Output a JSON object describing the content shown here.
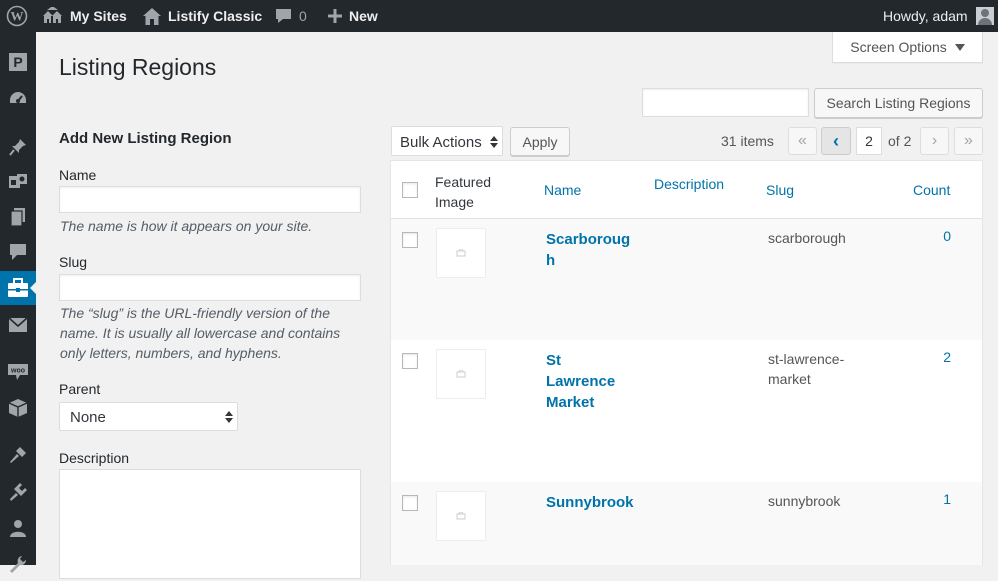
{
  "admin_bar": {
    "my_sites": "My Sites",
    "site_name": "Listify Classic",
    "comments_count": "0",
    "new_label": "New",
    "howdy": "Howdy, adam"
  },
  "page": {
    "title": "Listing Regions",
    "screen_options": "Screen Options"
  },
  "search": {
    "value": "",
    "button": "Search Listing Regions"
  },
  "form": {
    "heading": "Add New Listing Region",
    "name_label": "Name",
    "name_value": "",
    "name_help": "The name is how it appears on your site.",
    "slug_label": "Slug",
    "slug_value": "",
    "slug_help_lines": [
      "The “slug” is the URL-friendly version of the",
      "name. It is usually all lowercase and contains",
      "only letters, numbers, and hyphens."
    ],
    "parent_label": "Parent",
    "parent_selected": "None",
    "description_label": "Description",
    "description_value": ""
  },
  "tablenav": {
    "bulk_actions": "Bulk Actions",
    "apply": "Apply",
    "items_count": "31 items",
    "first_page": "«",
    "prev_page": "‹",
    "current_page": "2",
    "of_pages": "of 2",
    "next_page": "›",
    "last_page": "»"
  },
  "table": {
    "headers": {
      "featured_line1": "Featured",
      "featured_line2": "Image",
      "name": "Name",
      "description": "Description",
      "slug": "Slug",
      "count": "Count"
    },
    "rows": [
      {
        "name_lines": [
          "Scarboroug",
          "h"
        ],
        "slug_lines": [
          "scarborough"
        ],
        "count": "0"
      },
      {
        "name_lines": [
          "St",
          "Lawrence",
          "Market"
        ],
        "slug_lines": [
          "st-lawrence-",
          "market"
        ],
        "count": "2"
      },
      {
        "name_lines": [
          "Sunnybrook"
        ],
        "slug_lines": [
          "sunnybrook"
        ],
        "count": "1"
      }
    ]
  },
  "colors": {
    "admin_bar_bg": "#23282d",
    "accent_blue": "#0073aa",
    "page_bg": "#f1f1f1"
  }
}
